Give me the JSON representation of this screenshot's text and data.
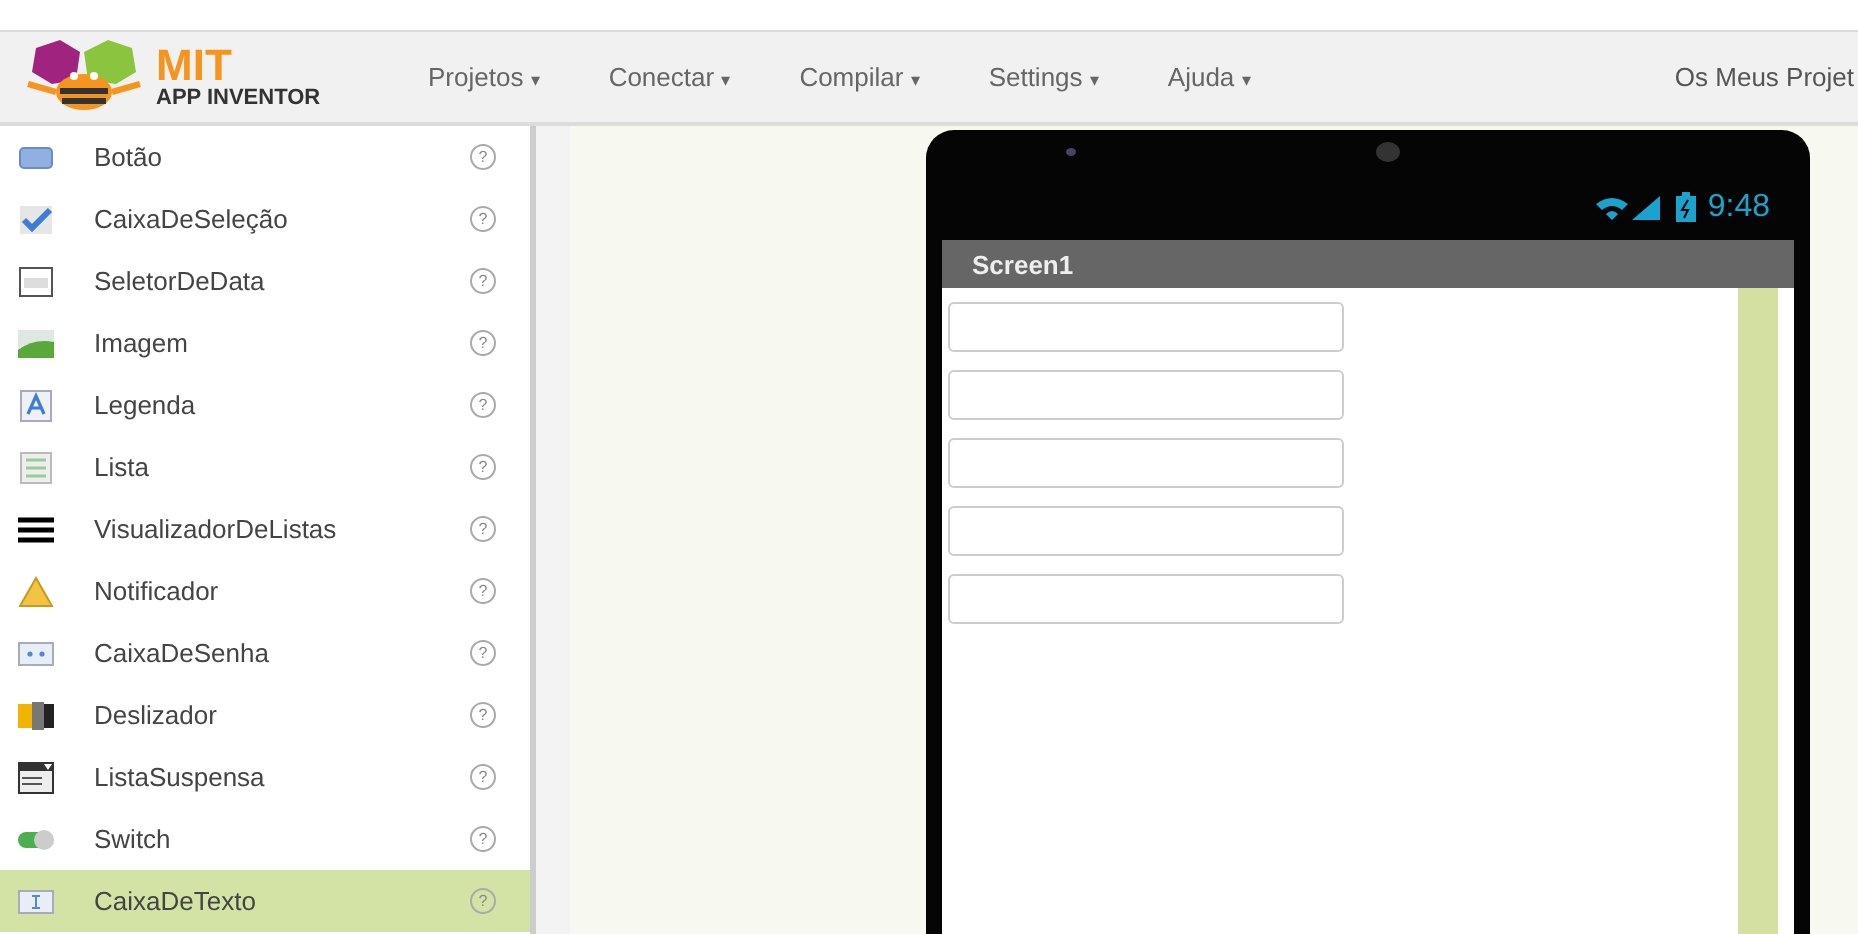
{
  "logo": {
    "title": "MIT",
    "subtitle": "APP INVENTOR"
  },
  "menus": [
    {
      "label": "Projetos",
      "caret": "▾"
    },
    {
      "label": "Conectar",
      "caret": "▾"
    },
    {
      "label": "Compilar",
      "caret": "▾"
    },
    {
      "label": "Settings",
      "caret": "▾"
    },
    {
      "label": "Ajuda",
      "caret": "▾"
    }
  ],
  "right_link": "Os Meus Projet",
  "palette": {
    "items": [
      {
        "kind": "button",
        "label": "Botão",
        "help": "?",
        "selected": false
      },
      {
        "kind": "checkbox",
        "label": "CaixaDeSeleção",
        "help": "?",
        "selected": false
      },
      {
        "kind": "datepicker",
        "label": "SeletorDeData",
        "help": "?",
        "selected": false
      },
      {
        "kind": "image",
        "label": "Imagem",
        "help": "?",
        "selected": false
      },
      {
        "kind": "label",
        "label": "Legenda",
        "help": "?",
        "selected": false
      },
      {
        "kind": "listpicker",
        "label": "Lista",
        "help": "?",
        "selected": false
      },
      {
        "kind": "listview",
        "label": "VisualizadorDeListas",
        "help": "?",
        "selected": false
      },
      {
        "kind": "notifier",
        "label": "Notificador",
        "help": "?",
        "selected": false
      },
      {
        "kind": "password",
        "label": "CaixaDeSenha",
        "help": "?",
        "selected": false
      },
      {
        "kind": "slider",
        "label": "Deslizador",
        "help": "?",
        "selected": false
      },
      {
        "kind": "spinner",
        "label": "ListaSuspensa",
        "help": "?",
        "selected": false
      },
      {
        "kind": "switch",
        "label": "Switch",
        "help": "?",
        "selected": false
      },
      {
        "kind": "textbox",
        "label": "CaixaDeTexto",
        "help": "?",
        "selected": true
      }
    ]
  },
  "phone": {
    "time": "9:48",
    "screen_title": "Screen1",
    "components": [
      {
        "kind": "textbox"
      },
      {
        "kind": "textbox"
      },
      {
        "kind": "textbox"
      },
      {
        "kind": "textbox"
      },
      {
        "kind": "textbox"
      }
    ]
  }
}
